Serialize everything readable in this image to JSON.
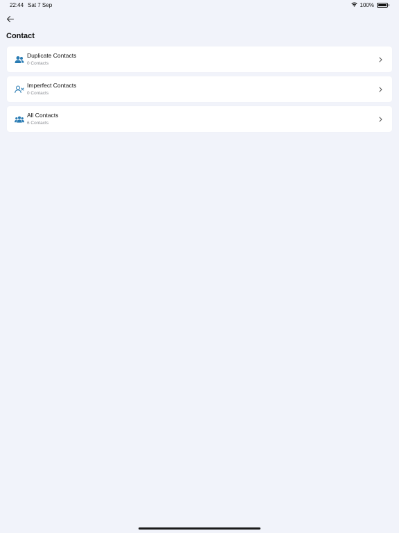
{
  "status_bar": {
    "time": "22:44",
    "date": "Sat 7 Sep",
    "battery": "100%"
  },
  "header": {
    "title": "Contact"
  },
  "items": [
    {
      "title": "Duplicate Contacts",
      "subtitle": "0 Contacts",
      "icon": "users-icon"
    },
    {
      "title": "Imperfect Contacts",
      "subtitle": "0 Contacts",
      "icon": "user-x-icon"
    },
    {
      "title": "All Contacts",
      "subtitle": "6 Contacts",
      "icon": "group-icon"
    }
  ],
  "colors": {
    "background": "#f1f3fa",
    "card": "#ffffff",
    "icon_accent": "#2a7cb4",
    "subtitle": "#8a8d93"
  }
}
